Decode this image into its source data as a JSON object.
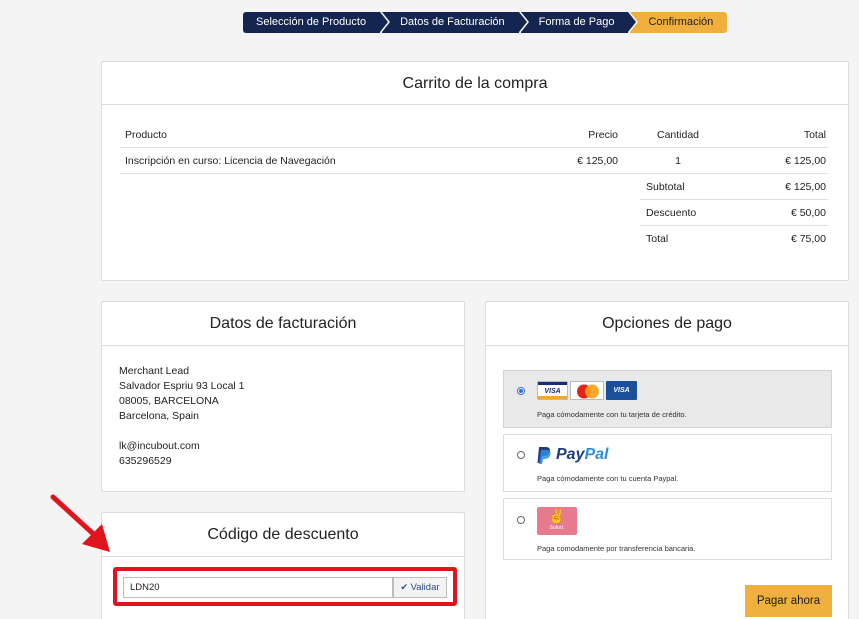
{
  "steps": [
    {
      "label": "Selección de Producto",
      "state": "done"
    },
    {
      "label": "Datos de Facturación",
      "state": "done"
    },
    {
      "label": "Forma de Pago",
      "state": "done"
    },
    {
      "label": "Confirmación",
      "state": "active"
    }
  ],
  "cart": {
    "title": "Carrito de la compra",
    "headers": {
      "product": "Producto",
      "price": "Precio",
      "quantity": "Cantidad",
      "total": "Total"
    },
    "items": [
      {
        "product": "Inscripción en curso: Licencia de Navegación",
        "price": "€ 125,00",
        "quantity": "1",
        "total": "€ 125,00"
      }
    ],
    "summary": [
      {
        "label": "Subtotal",
        "value": "€ 125,00"
      },
      {
        "label": "Descuento",
        "value": "€ 50,00"
      },
      {
        "label": "Total",
        "value": "€ 75,00"
      }
    ]
  },
  "billing": {
    "title": "Datos de facturación",
    "name": "Merchant Lead",
    "address1": "Salvador Espriu 93 Local 1",
    "address2": "08005, BARCELONA",
    "address3": "Barcelona, Spain",
    "email": "lk@incubout.com",
    "phone": "635296529"
  },
  "discount": {
    "title": "Código de descuento",
    "code_value": "LDN20",
    "validate_label": "Validar",
    "highlight_color": "#e0141c"
  },
  "payment": {
    "title": "Opciones de pago",
    "options": [
      {
        "id": "card",
        "selected": true,
        "description": "Paga cómodamente con tu tarjeta de crédito.",
        "logos": [
          "VISA",
          "MasterCard",
          "VISA Electron"
        ]
      },
      {
        "id": "paypal",
        "selected": false,
        "description": "Paga cómodamente con tu cuenta Paypal.",
        "logo_text_1": "Pay",
        "logo_text_2": "Pal"
      },
      {
        "id": "sofort",
        "selected": false,
        "description": "Paga comodamente por transferencia bancaria.",
        "logo_text": "Sofort."
      }
    ],
    "pay_button": "Pagar ahora"
  },
  "colors": {
    "step_nav": "#14254f",
    "accent": "#f0b03d",
    "radio_selected": "#2d6bd8"
  }
}
